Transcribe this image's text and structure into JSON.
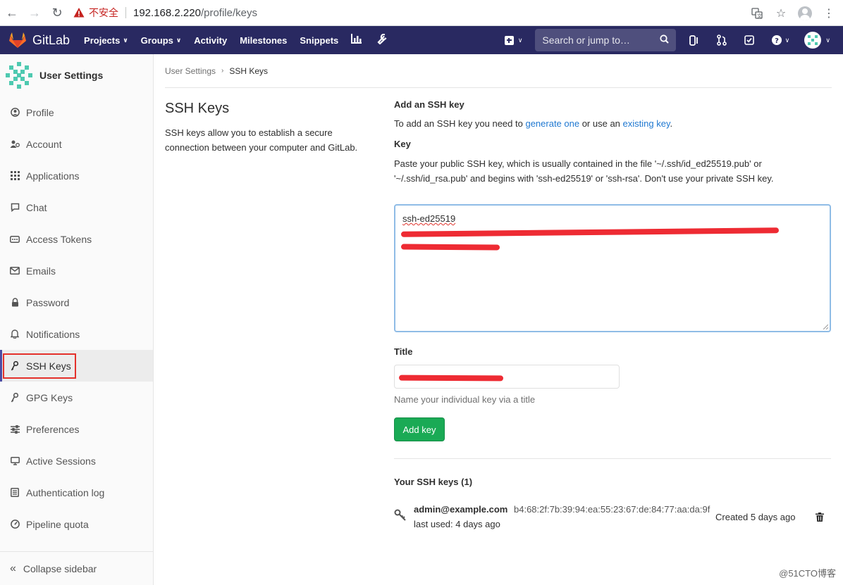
{
  "browser": {
    "security_label": "不安全",
    "url_host": "192.168.2.220",
    "url_path": "/profile/keys"
  },
  "navbar": {
    "brand": "GitLab",
    "items": [
      {
        "label": "Projects",
        "caret": true
      },
      {
        "label": "Groups",
        "caret": true
      },
      {
        "label": "Activity",
        "caret": false
      },
      {
        "label": "Milestones",
        "caret": false
      },
      {
        "label": "Snippets",
        "caret": false
      }
    ],
    "search_placeholder": "Search or jump to…",
    "colors": {
      "background": "#292961"
    }
  },
  "sidebar": {
    "title": "User Settings",
    "items": [
      {
        "label": "Profile",
        "icon": "profile-icon"
      },
      {
        "label": "Account",
        "icon": "account-icon"
      },
      {
        "label": "Applications",
        "icon": "applications-icon"
      },
      {
        "label": "Chat",
        "icon": "chat-icon"
      },
      {
        "label": "Access Tokens",
        "icon": "access-tokens-icon"
      },
      {
        "label": "Emails",
        "icon": "emails-icon"
      },
      {
        "label": "Password",
        "icon": "lock-icon"
      },
      {
        "label": "Notifications",
        "icon": "bell-icon"
      },
      {
        "label": "SSH Keys",
        "icon": "key-icon",
        "active": true
      },
      {
        "label": "GPG Keys",
        "icon": "key-icon"
      },
      {
        "label": "Preferences",
        "icon": "sliders-icon"
      },
      {
        "label": "Active Sessions",
        "icon": "monitor-icon"
      },
      {
        "label": "Authentication log",
        "icon": "log-icon"
      },
      {
        "label": "Pipeline quota",
        "icon": "quota-icon"
      }
    ],
    "collapse_label": "Collapse sidebar"
  },
  "breadcrumb": {
    "parent": "User Settings",
    "current": "SSH Keys"
  },
  "intro": {
    "title": "SSH Keys",
    "description": "SSH keys allow you to establish a secure connection between your computer and GitLab."
  },
  "form": {
    "heading": "Add an SSH key",
    "instructions_pre": "To add an SSH key you need to ",
    "generate_link": "generate one",
    "instructions_mid": " or use an ",
    "existing_link": "existing key",
    "instructions_post": ".",
    "key_label": "Key",
    "key_help": "Paste your public SSH key, which is usually contained in the file '~/.ssh/id_ed25519.pub' or '~/.ssh/id_rsa.pub' and begins with 'ssh-ed25519' or 'ssh-rsa'. Don't use your private SSH key.",
    "key_value": "ssh-ed25519",
    "title_label": "Title",
    "title_help": "Name your individual key via a title",
    "submit_label": "Add key"
  },
  "keys": {
    "heading": "Your SSH keys (1)",
    "items": [
      {
        "title": "admin@example.com",
        "fingerprint": "b4:68:2f:7b:39:94:ea:55:23:67:de:84:77:aa:da:9f",
        "last_used": "last used: 4 days ago",
        "created": "Created 5 days ago"
      }
    ]
  },
  "watermark": "@51CTO博客"
}
